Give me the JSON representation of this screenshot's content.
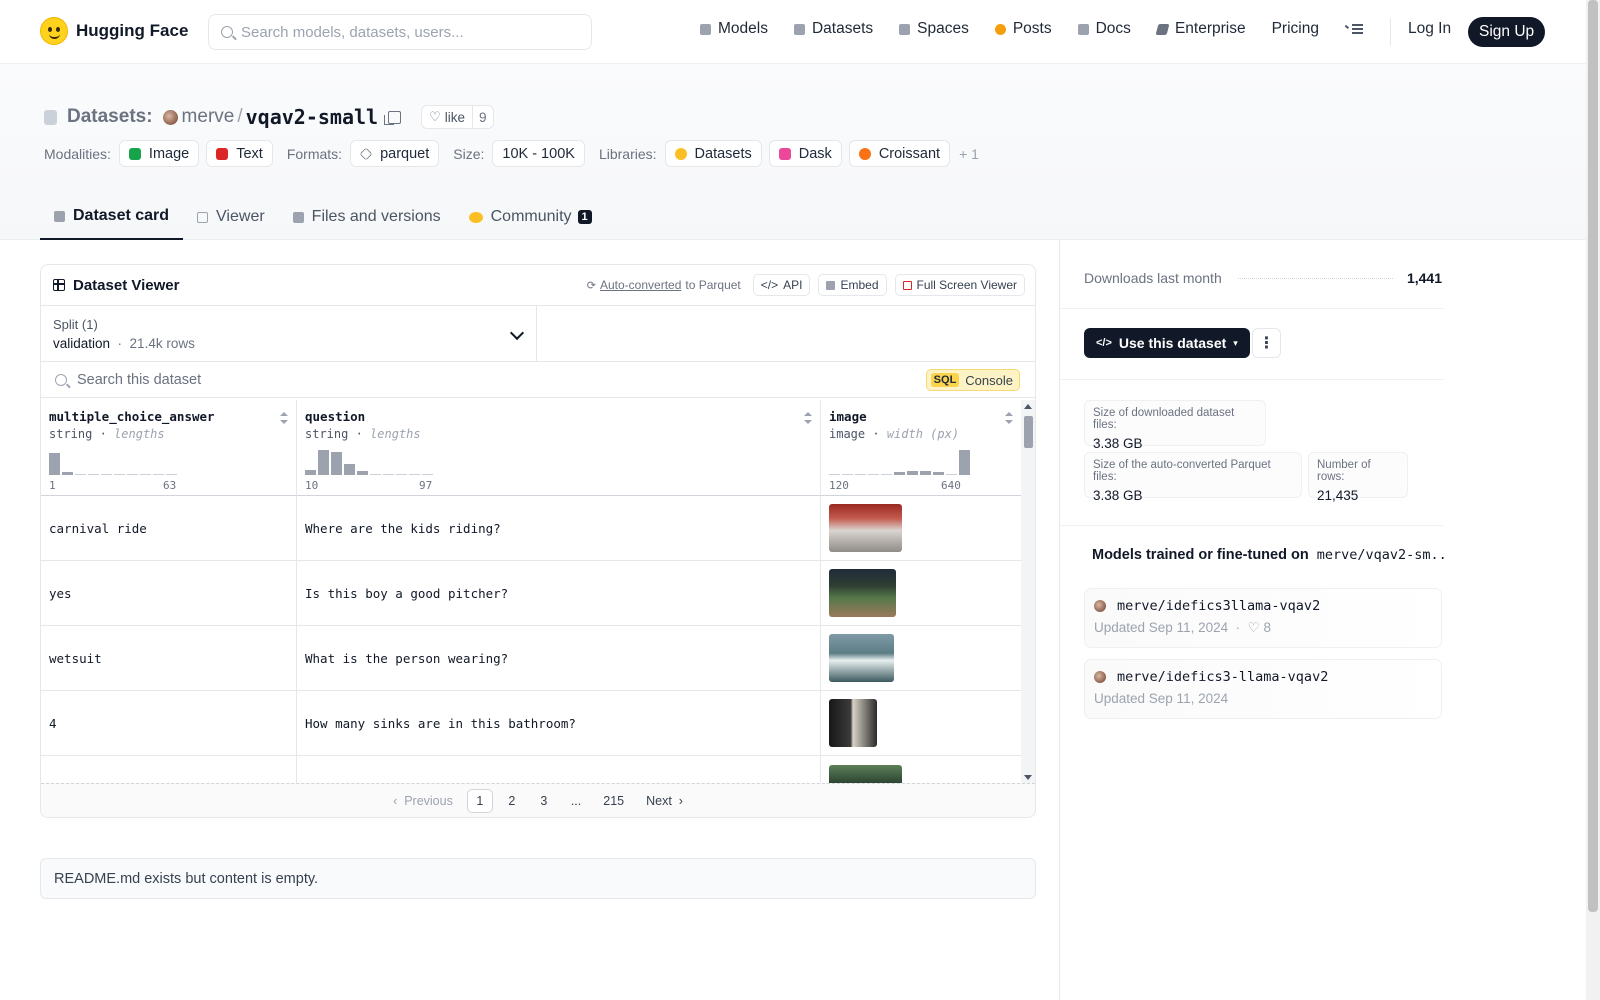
{
  "nav": {
    "brand": "Hugging Face",
    "search_placeholder": "Search models, datasets, users...",
    "items": [
      "Models",
      "Datasets",
      "Spaces",
      "Posts",
      "Docs",
      "Enterprise",
      "Pricing"
    ],
    "login": "Log In",
    "signup": "Sign Up"
  },
  "header": {
    "section": "Datasets:",
    "user": "merve",
    "sep": "/",
    "name": "vqav2-small",
    "like_label": "like",
    "like_count": "9",
    "modalities_label": "Modalities:",
    "modalities": [
      "Image",
      "Text"
    ],
    "formats_label": "Formats:",
    "format": "parquet",
    "size_label": "Size:",
    "size": "10K - 100K",
    "libraries_label": "Libraries:",
    "libraries": [
      "Datasets",
      "Dask",
      "Croissant"
    ],
    "libraries_more": "+ 1"
  },
  "tabs": [
    "Dataset card",
    "Viewer",
    "Files and versions",
    "Community"
  ],
  "community_badge": "1",
  "viewer": {
    "title": "Dataset Viewer",
    "auto_converted": "Auto-converted",
    "to_parquet": "to Parquet",
    "api": "API",
    "embed": "Embed",
    "full_screen": "Full Screen Viewer",
    "split_label": "Split (1)",
    "split_value": "validation",
    "split_rows": "21.4k rows",
    "search_placeholder": "Search this dataset",
    "sql_tag": "SQL",
    "console": "Console",
    "columns": [
      {
        "name": "multiple_choice_answer",
        "type": "string",
        "stat": "lengths",
        "min": "1",
        "max": "63",
        "hist": [
          0.85,
          0.12,
          0,
          0,
          0,
          0,
          0,
          0,
          0,
          0
        ]
      },
      {
        "name": "question",
        "type": "string",
        "stat": "lengths",
        "min": "10",
        "max": "97",
        "hist": [
          0.2,
          0.95,
          0.9,
          0.42,
          0.17,
          0,
          0,
          0,
          0,
          0
        ]
      },
      {
        "name": "image",
        "type": "image",
        "stat": "width (px)",
        "min": "120",
        "max": "640",
        "hist": [
          0,
          0,
          0,
          0,
          0,
          0.12,
          0.15,
          0.15,
          0.1,
          0,
          0.95
        ]
      }
    ],
    "rows": [
      {
        "answer": "carnival ride",
        "question": "Where are the kids riding?",
        "thumb": "carnival"
      },
      {
        "answer": "yes",
        "question": "Is this boy a good pitcher?",
        "thumb": "baseball"
      },
      {
        "answer": "wetsuit",
        "question": "What is the person wearing?",
        "thumb": "wave"
      },
      {
        "answer": "4",
        "question": "How many sinks are in this bathroom?",
        "thumb": "bathroom"
      },
      {
        "answer": "",
        "question": "",
        "thumb": "field"
      }
    ],
    "pager": {
      "prev": "Previous",
      "pages": [
        "1",
        "2",
        "3",
        "...",
        "215"
      ],
      "next": "Next"
    }
  },
  "readme": "README.md exists but content is empty.",
  "sidebar": {
    "downloads_label": "Downloads last month",
    "downloads_value": "1,441",
    "use_button": "Use this dataset",
    "stats": [
      {
        "label": "Size of downloaded dataset files:",
        "value": "3.38 GB"
      },
      {
        "label": "Size of the auto-converted Parquet files:",
        "value": "3.38 GB"
      },
      {
        "label": "Number of rows:",
        "value": "21,435"
      }
    ],
    "models_heading": "Models trained or fine-tuned on",
    "models_heading_repo": "merve/vqav2-sm...",
    "models": [
      {
        "name": "merve/idefics3llama-vqav2",
        "updated": "Updated Sep 11, 2024",
        "likes": "8"
      },
      {
        "name": "merve/idefics3-llama-vqav2",
        "updated": "Updated Sep 11, 2024",
        "likes": ""
      }
    ]
  }
}
